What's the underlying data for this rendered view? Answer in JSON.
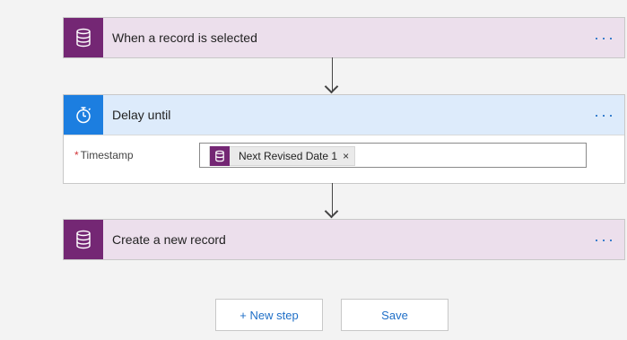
{
  "steps": [
    {
      "title": "When a record is selected",
      "icon": "database-icon"
    },
    {
      "title": "Delay until",
      "icon": "stopwatch-icon",
      "field": {
        "label": "Timestamp",
        "required_mark": "*",
        "token": {
          "label": "Next Revised Date 1",
          "remove": "×",
          "icon": "database-icon"
        }
      }
    },
    {
      "title": "Create a new record",
      "icon": "database-icon"
    }
  ],
  "more_glyph": "···",
  "buttons": {
    "new_step": "+ New step",
    "save": "Save"
  },
  "colors": {
    "dataverse_purple": "#742774",
    "schedule_blue": "#1c7ee0",
    "link_blue": "#1f6fc7"
  }
}
